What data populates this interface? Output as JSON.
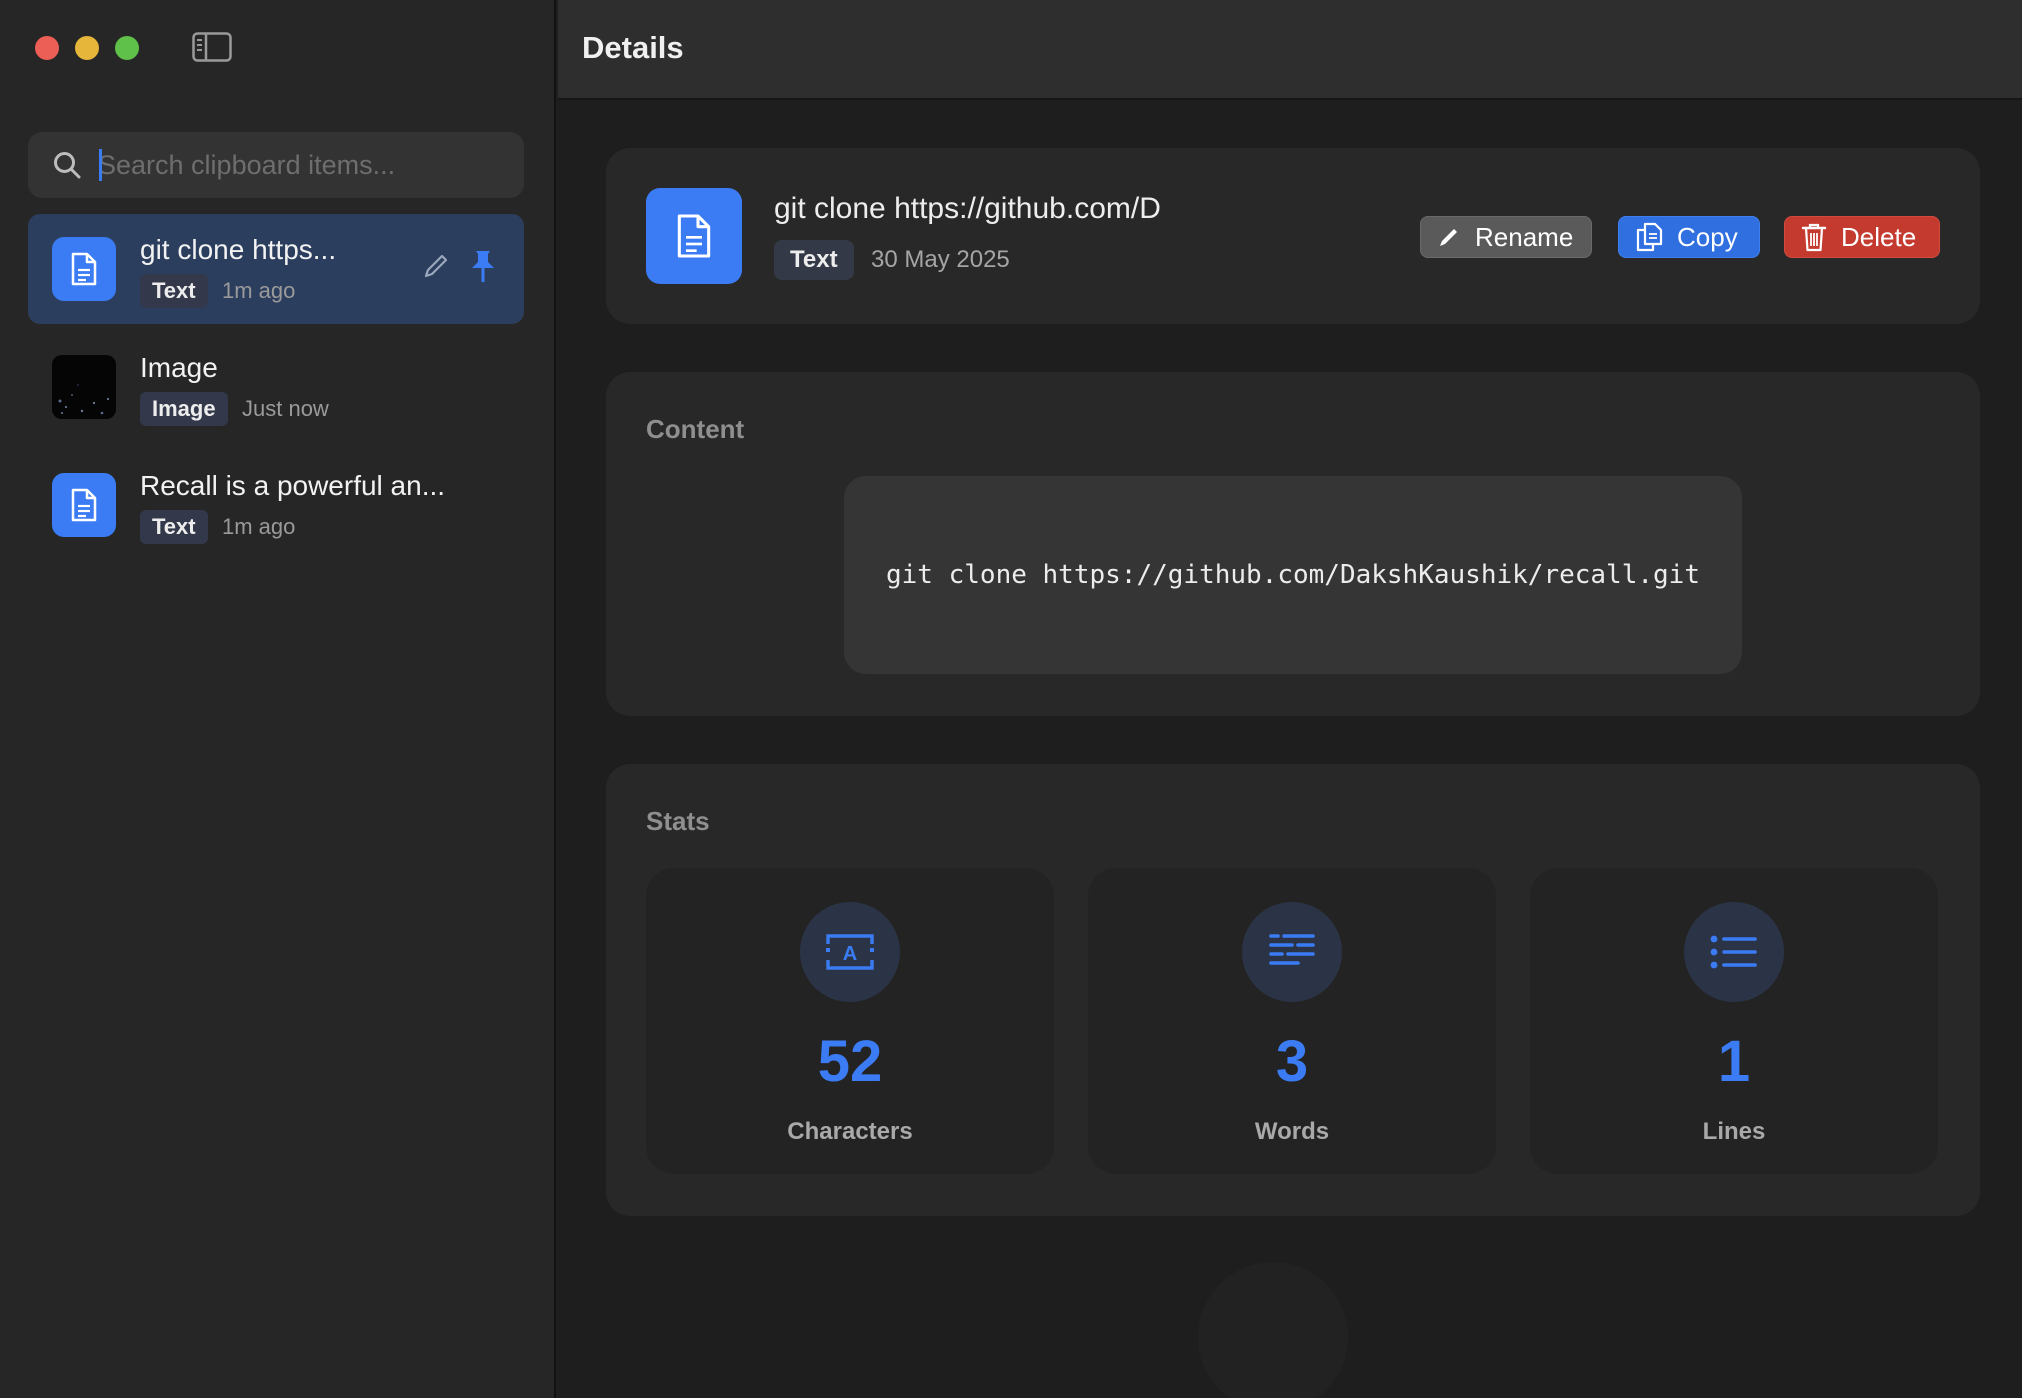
{
  "sidebar": {
    "search": {
      "placeholder": "Search clipboard items...",
      "value": ""
    },
    "items": [
      {
        "title": "git clone https...",
        "badge": "Text",
        "time": "1m ago",
        "selected": true,
        "pinned": true
      },
      {
        "title": "Image",
        "badge": "Image",
        "time": "Just now",
        "selected": false
      },
      {
        "title": "Recall is a powerful an...",
        "badge": "Text",
        "time": "1m ago",
        "selected": false
      }
    ]
  },
  "header": {
    "title": "Details"
  },
  "detail": {
    "title": "git clone https://github.com/D",
    "badge": "Text",
    "date": "30 May 2025",
    "actions": {
      "rename": "Rename",
      "copy": "Copy",
      "delete": "Delete"
    }
  },
  "content": {
    "label": "Content",
    "text": "git clone https://github.com/DakshKaushik/recall.git"
  },
  "stats": {
    "label": "Stats",
    "items": [
      {
        "value": "52",
        "label": "Characters",
        "icon": "text-format-icon"
      },
      {
        "value": "3",
        "label": "Words",
        "icon": "text-lines-icon"
      },
      {
        "value": "1",
        "label": "Lines",
        "icon": "list-icon"
      }
    ]
  },
  "colors": {
    "accent": "#3b7cf5",
    "delete": "#c43a2f",
    "rename": "#5a5a5a",
    "selected_row": "#2c3e5e"
  }
}
